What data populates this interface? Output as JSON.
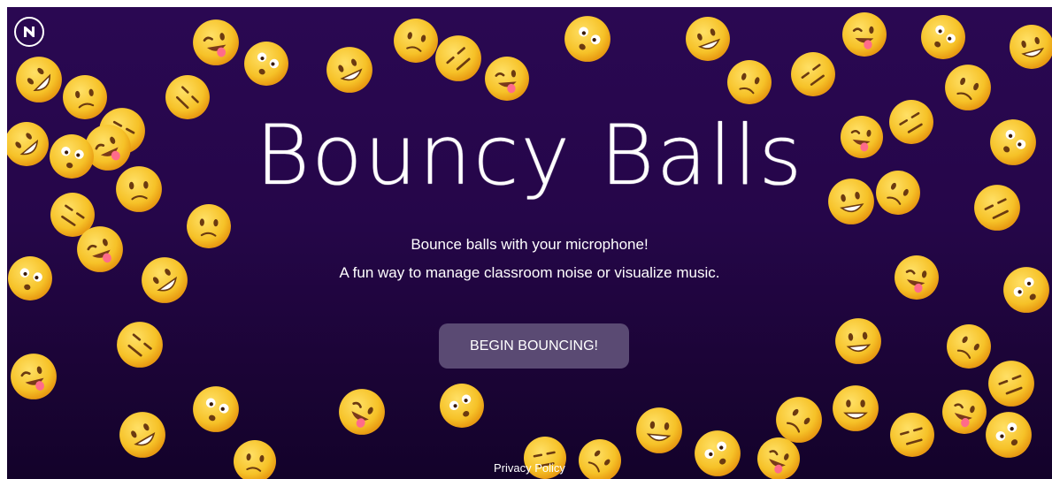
{
  "app": {
    "title": "Bouncy Balls",
    "subtitle_line1": "Bounce balls with your microphone!",
    "subtitle_line2": "A fun way to manage classroom noise or visualize music.",
    "start_button_label": "BEGIN BOUNCING!",
    "privacy_link": "Privacy Policy",
    "logo_icon": "n-logo-icon"
  },
  "colors": {
    "background_top": "#2a0852",
    "background_bottom": "#13022a",
    "button_bg": "#5a4a73",
    "emoji_yellow": "#f6c228",
    "text": "#ffffff"
  },
  "emojis": [
    {
      "name": "winking-tongue-emoji-ball"
    },
    {
      "name": "tongue-out-emoji-ball"
    },
    {
      "name": "big-grin-emoji-ball"
    },
    {
      "name": "crying-emoji-ball"
    },
    {
      "name": "sad-sweat-emoji-ball"
    },
    {
      "name": "sunglasses-emoji-ball"
    },
    {
      "name": "laughing-tears-emoji-ball"
    },
    {
      "name": "heart-eyes-emoji-ball"
    },
    {
      "name": "kiss-heart-emoji-ball"
    },
    {
      "name": "bandage-emoji-ball"
    },
    {
      "name": "zipper-mouth-emoji-ball"
    },
    {
      "name": "money-mouth-emoji-ball"
    },
    {
      "name": "nerd-emoji-ball"
    },
    {
      "name": "dizzy-emoji-ball"
    },
    {
      "name": "sleeping-emoji-ball"
    },
    {
      "name": "flushed-emoji-ball"
    },
    {
      "name": "expressionless-emoji-ball"
    },
    {
      "name": "grimacing-emoji-ball"
    },
    {
      "name": "thermometer-emoji-ball"
    },
    {
      "name": "slight-smile-emoji-ball"
    }
  ]
}
